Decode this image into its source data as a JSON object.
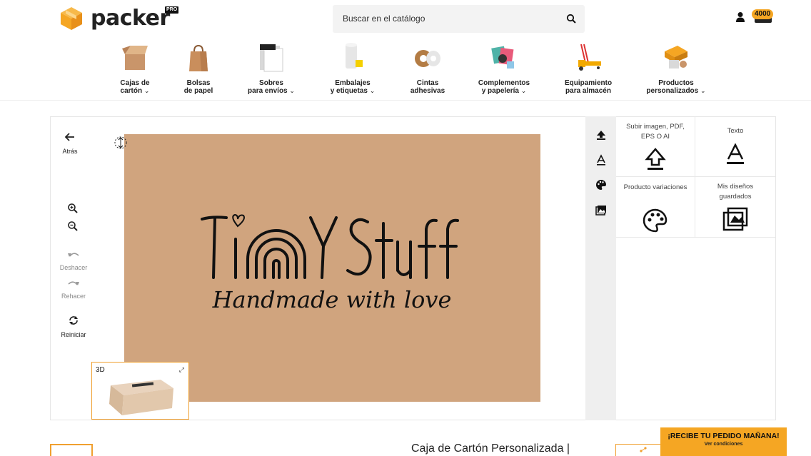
{
  "header": {
    "logo_text": "packer",
    "logo_badge": "PRO",
    "search_placeholder": "Buscar en el catálogo",
    "cart_count": "4000"
  },
  "categories": [
    {
      "line1": "Cajas de",
      "line2": "cartón",
      "has_dropdown": true,
      "icon": "box-icon"
    },
    {
      "line1": "Bolsas",
      "line2": "de papel",
      "has_dropdown": false,
      "icon": "paper-bag-icon"
    },
    {
      "line1": "Sobres",
      "line2": "para envíos",
      "has_dropdown": true,
      "icon": "envelope-icon"
    },
    {
      "line1": "Embalajes",
      "line2": "y etiquetas",
      "has_dropdown": true,
      "icon": "bubble-wrap-icon"
    },
    {
      "line1": "Cintas",
      "line2": "adhesivas",
      "has_dropdown": false,
      "icon": "tape-icon"
    },
    {
      "line1": "Complementos",
      "line2": "y papelería",
      "has_dropdown": true,
      "icon": "stationery-icon"
    },
    {
      "line1": "Equipamiento",
      "line2": "para almacén",
      "has_dropdown": false,
      "icon": "pallet-jack-icon"
    },
    {
      "line1": "Productos",
      "line2": "personalizados",
      "has_dropdown": true,
      "icon": "custom-box-icon"
    }
  ],
  "tools": {
    "back": "Atrás",
    "undo": "Deshacer",
    "redo": "Rehacer",
    "reset": "Reiniciar"
  },
  "design": {
    "logo_title": "TiNY STuff",
    "tagline": "Handmade with love",
    "canvas_color": "#d0a47e"
  },
  "preview3d": {
    "label": "3D"
  },
  "panel": {
    "upload": "Subir imagen, PDF, EPS O AI",
    "text": "Texto",
    "variations": "Producto variaciones",
    "saved": "Mis diseños guardados"
  },
  "footer": {
    "product_title": "Caja de Cartón Personalizada |",
    "promo_title": "¡RECIBE TU PEDIDO MAÑANA!",
    "promo_sub": "Ver condiciones"
  },
  "colors": {
    "accent": "#f5a623",
    "kraft": "#d0a47e"
  }
}
